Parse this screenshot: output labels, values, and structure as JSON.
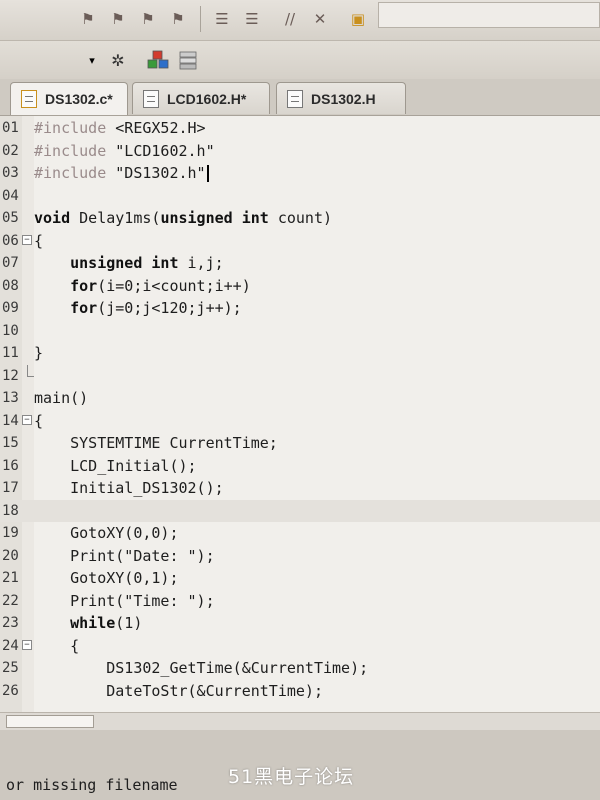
{
  "toolbar": {
    "buttons": [
      "bookmark-icon",
      "bookmark-prev-icon",
      "bookmark-next-icon",
      "bookmark-clear-icon",
      "indent-icon",
      "outdent-icon",
      "comment-icon",
      "uncomment-icon",
      "find-in-files-icon"
    ],
    "combo_value": ""
  },
  "tabs": [
    {
      "label": "DS1302.c*",
      "active": true
    },
    {
      "label": "LCD1602.H*",
      "active": false
    },
    {
      "label": "DS1302.H",
      "active": false
    }
  ],
  "editor": {
    "current_line": 18,
    "lines": [
      {
        "num": "01",
        "text": "#include <REGX52.H>"
      },
      {
        "num": "02",
        "text": "#include \"LCD1602.h\""
      },
      {
        "num": "03",
        "text": "#include \"DS1302.h\""
      },
      {
        "num": "04",
        "text": ""
      },
      {
        "num": "05",
        "text": "void Delay1ms(unsigned int count)"
      },
      {
        "num": "06",
        "text": "{"
      },
      {
        "num": "07",
        "text": "    unsigned int i,j;"
      },
      {
        "num": "08",
        "text": "    for(i=0;i<count;i++)"
      },
      {
        "num": "09",
        "text": "    for(j=0;j<120;j++);"
      },
      {
        "num": "10",
        "text": ""
      },
      {
        "num": "11",
        "text": "}"
      },
      {
        "num": "12",
        "text": ""
      },
      {
        "num": "13",
        "text": "main()"
      },
      {
        "num": "14",
        "text": "{"
      },
      {
        "num": "15",
        "text": "    SYSTEMTIME CurrentTime;"
      },
      {
        "num": "16",
        "text": "    LCD_Initial();"
      },
      {
        "num": "17",
        "text": "    Initial_DS1302();"
      },
      {
        "num": "18",
        "text": ""
      },
      {
        "num": "19",
        "text": "    GotoXY(0,0);"
      },
      {
        "num": "20",
        "text": "    Print(\"Date: \");"
      },
      {
        "num": "21",
        "text": "    GotoXY(0,1);"
      },
      {
        "num": "22",
        "text": "    Print(\"Time: \");"
      },
      {
        "num": "23",
        "text": "    while(1)"
      },
      {
        "num": "24",
        "text": "    {"
      },
      {
        "num": "25",
        "text": "        DS1302_GetTime(&CurrentTime);"
      },
      {
        "num": "26",
        "text": "        DateToStr(&CurrentTime);"
      }
    ]
  },
  "output": {
    "text": "or missing filename"
  },
  "watermark": "51黑电子论坛"
}
